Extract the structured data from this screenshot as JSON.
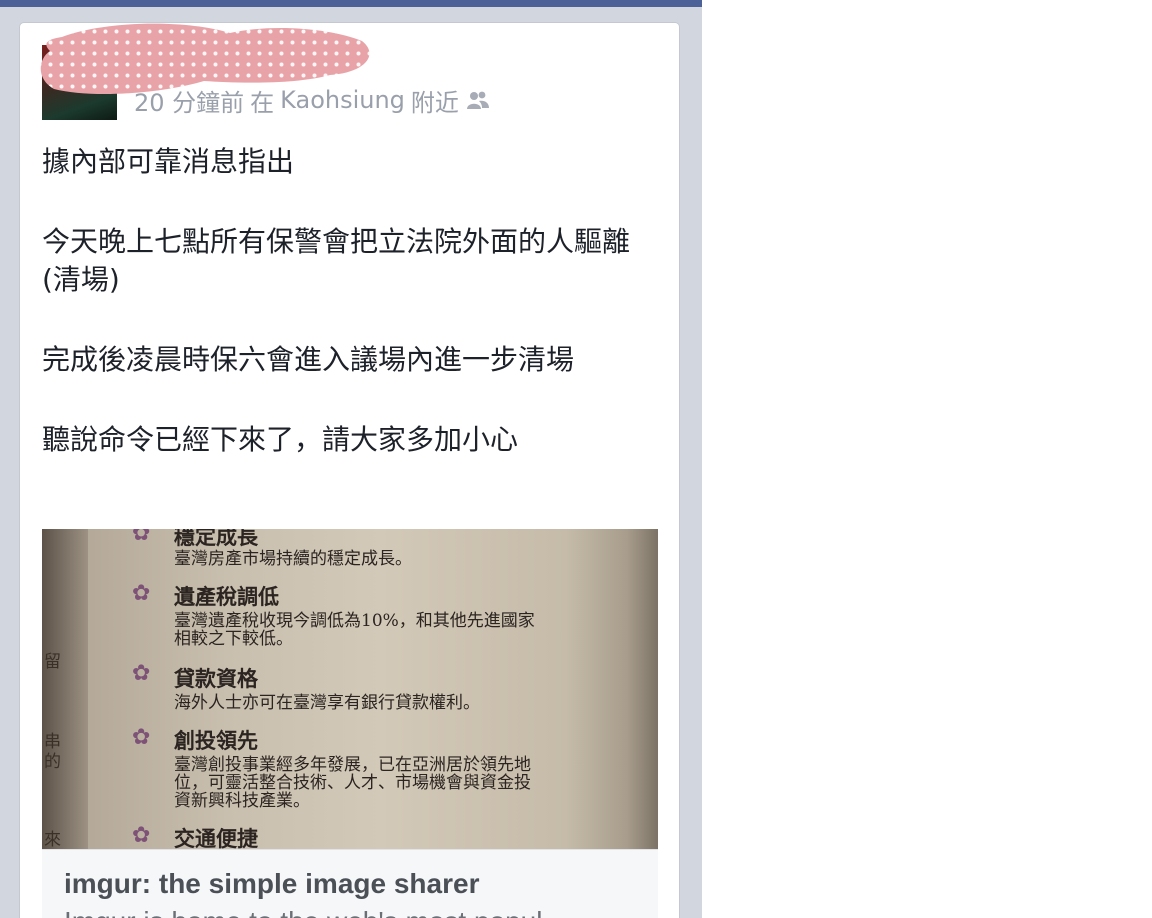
{
  "post": {
    "meta": {
      "time": "20 分鐘前",
      "location_prefix": "在",
      "location": "Kaohsiung",
      "location_suffix": "附近",
      "audience_icon": "friends-icon"
    },
    "paragraphs": [
      "據內部可靠消息指出",
      "今天晚上七點所有保警會把立法院外面的人驅離(清場)",
      "完成後凌晨時保六會進入議場內進一步清場",
      "聽說命令已經下來了，請大家多加小心"
    ]
  },
  "photo": {
    "items": [
      {
        "heading": "穩定成長",
        "lines": [
          "臺灣房產市場持續的穩定成長。"
        ]
      },
      {
        "heading": "遺產稅調低",
        "lines": [
          "臺灣遺產稅收現今調低為10%，和其他先進國家",
          "相較之下較低。"
        ]
      },
      {
        "heading": "貸款資格",
        "lines": [
          "海外人士亦可在臺灣享有銀行貸款權利。"
        ]
      },
      {
        "heading": "創投領先",
        "lines": [
          "臺灣創投事業經多年發展，已在亞洲居於領先地",
          "位，可靈活整合技術、人才、市場機會與資金投",
          "資新興科技產業。"
        ]
      },
      {
        "heading": "交通便捷",
        "lines": []
      }
    ],
    "edge_chars": [
      "留",
      "串",
      "的",
      "來"
    ]
  },
  "link_preview": {
    "title": "imgur: the simple image sharer",
    "description": "Imgur is home to the web's most popul"
  },
  "colors": {
    "top_bar": "#4b6198",
    "feed_background": "#d2d6df",
    "scribble": "#e8a3a8"
  }
}
